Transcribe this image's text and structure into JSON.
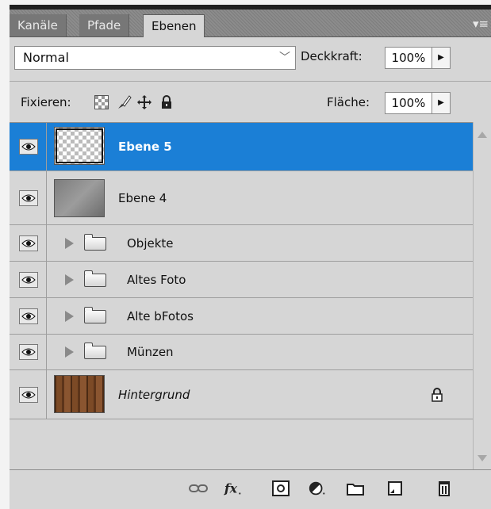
{
  "tabs": [
    {
      "label": "Kanäle"
    },
    {
      "label": "Pfade"
    },
    {
      "label": "Ebenen"
    }
  ],
  "panel_menu_icon": "panel-menu-icon",
  "blend": {
    "value": "Normal",
    "options_icon": "chevron-down-icon"
  },
  "opacity": {
    "label": "Deckkraft:",
    "value": "100%"
  },
  "lock": {
    "label": "Fixieren:",
    "icons": [
      "lock-transparent-icon",
      "lock-image-icon",
      "lock-position-icon",
      "lock-all-icon"
    ]
  },
  "fill": {
    "label": "Fläche:",
    "value": "100%"
  },
  "layers": [
    {
      "name": "Ebene 5",
      "type": "layer",
      "thumb": "transparent",
      "selected": true
    },
    {
      "name": "Ebene 4",
      "type": "layer",
      "thumb": "grey",
      "selected": false
    },
    {
      "name": "Objekte",
      "type": "group"
    },
    {
      "name": "Altes Foto",
      "type": "group"
    },
    {
      "name": "Alte bFotos",
      "type": "group"
    },
    {
      "name": "Münzen",
      "type": "group"
    },
    {
      "name": "Hintergrund",
      "type": "background",
      "thumb": "wood",
      "locked": true
    }
  ],
  "footer_icons": [
    "link-layers-icon",
    "fx-icon",
    "layer-mask-icon",
    "adjustment-layer-icon",
    "new-group-icon",
    "new-layer-icon",
    "trash-icon"
  ],
  "colors": {
    "selection": "#1b7fd6",
    "panel": "#d6d6d6",
    "tabbar": "#7d7d7d"
  }
}
